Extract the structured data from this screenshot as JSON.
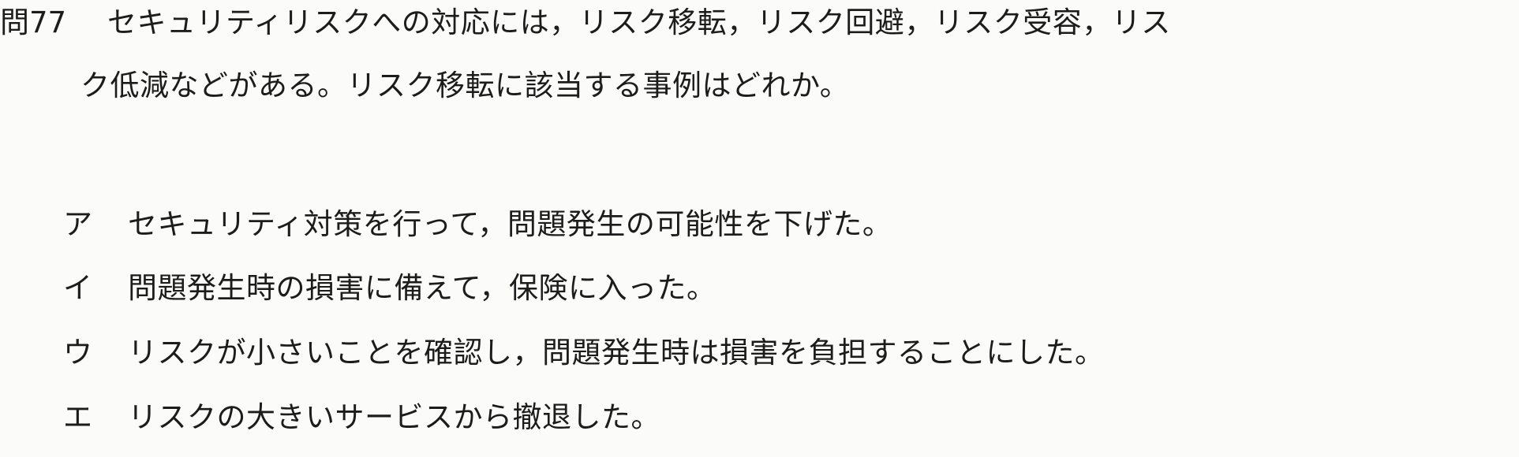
{
  "question": {
    "number": "問77",
    "text_line1": "セキュリティリスクへの対応には，リスク移転，リスク回避，リスク受容，リス",
    "text_line2": "ク低減などがある。リスク移転に該当する事例はどれか。"
  },
  "choices": [
    {
      "mark": "ア",
      "text": "セキュリティ対策を行って，問題発生の可能性を下げた。"
    },
    {
      "mark": "イ",
      "text": "問題発生時の損害に備えて，保険に入った。"
    },
    {
      "mark": "ウ",
      "text": "リスクが小さいことを確認し，問題発生時は損害を負担することにした。"
    },
    {
      "mark": "エ",
      "text": "リスクの大きいサービスから撤退した。"
    }
  ]
}
